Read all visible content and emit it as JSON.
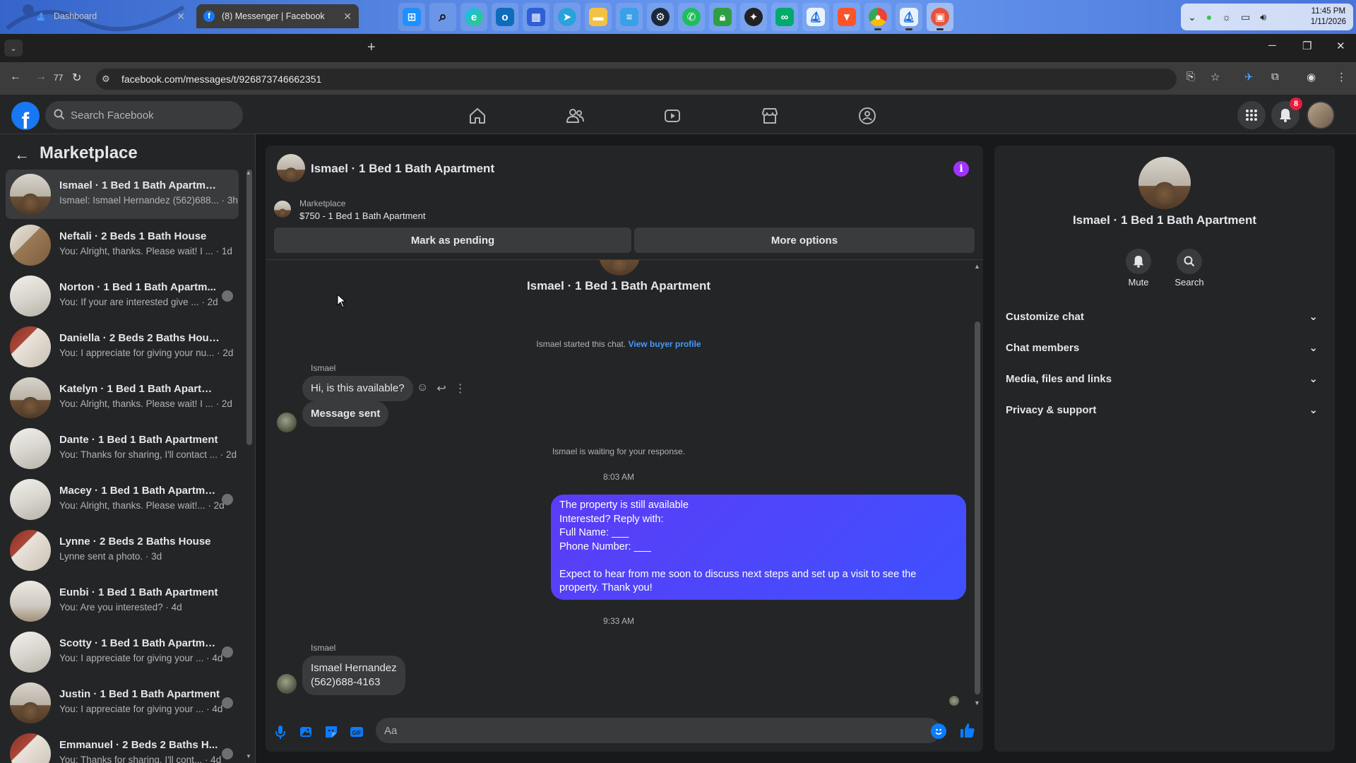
{
  "taskbar": {
    "icons": [
      "windows-start",
      "search",
      "edge-copilot",
      "outlook",
      "microsoft-store",
      "telegram",
      "file-explorer",
      "notepad",
      "steam",
      "whatsapp",
      "lock-app",
      "lightbulb-app",
      "tripadvisor",
      "sailing-app",
      "brave",
      "chrome",
      "sailing-app-2",
      "printer-app"
    ],
    "clock_time": "11:45 PM",
    "clock_date": "1/11/2026"
  },
  "browser": {
    "tabs": [
      {
        "title": "Dashboard",
        "active": false
      },
      {
        "title": "(8) Messenger | Facebook",
        "active": true
      }
    ],
    "reload_count": "77",
    "url": "facebook.com/messages/t/926873746662351"
  },
  "facebook": {
    "search_placeholder": "Search Facebook",
    "notification_count": "8"
  },
  "left": {
    "title": "Marketplace",
    "conversations": [
      {
        "name": "Ismael · 1 Bed 1 Bath Apartment",
        "snippet": "Ismael: Ismael Hernandez (562)688... · 3h",
        "thumb": "h1"
      },
      {
        "name": "Neftali · 2 Beds 1 Bath House",
        "snippet": "You: Alright, thanks. Please wait! I ... · 1d",
        "thumb": "h2"
      },
      {
        "name": "Norton · 1 Bed 1 Bath Apartm...",
        "snippet": "You: If your are interested give ... · 2d",
        "thumb": "h3"
      },
      {
        "name": "Daniella · 2 Beds 2 Baths House",
        "snippet": "You: I appreciate for giving your nu... · 2d",
        "thumb": "h4"
      },
      {
        "name": "Katelyn · 1 Bed 1 Bath Apartment",
        "snippet": "You: Alright, thanks. Please wait! I ... · 2d",
        "thumb": "h1"
      },
      {
        "name": "Dante · 1 Bed 1 Bath Apartment",
        "snippet": "You: Thanks for sharing, I'll contact ... · 2d",
        "thumb": "h3"
      },
      {
        "name": "Macey · 1 Bed 1 Bath Apartment",
        "snippet": "You: Alright, thanks. Please wait!... · 2d",
        "thumb": "h3"
      },
      {
        "name": "Lynne · 2 Beds 2 Baths House",
        "snippet": "Lynne sent a photo. · 3d",
        "thumb": "h4"
      },
      {
        "name": "Eunbi · 1 Bed 1 Bath Apartment",
        "snippet": "You: Are you interested? · 4d",
        "thumb": "h5"
      },
      {
        "name": "Scotty · 1 Bed 1 Bath Apartment",
        "snippet": "You: I appreciate for giving your ... · 4d",
        "thumb": "h3"
      },
      {
        "name": "Justin · 1 Bed 1 Bath Apartment",
        "snippet": "You: I appreciate for giving your ... · 4d",
        "thumb": "h1"
      },
      {
        "name": "Emmanuel · 2 Beds 2 Baths H...",
        "snippet": "You: Thanks for sharing. I'll cont... · 4d",
        "thumb": "h4"
      }
    ]
  },
  "chat": {
    "title": "Ismael · 1 Bed 1 Bath Apartment",
    "marketplace_label": "Marketplace",
    "listing": "$750 - 1 Bed 1 Bath Apartment",
    "mark_pending": "Mark as pending",
    "more_options": "More options",
    "center_title": "Ismael · 1 Bed 1 Bath Apartment",
    "started_text": "Ismael started this chat.",
    "view_profile": "View buyer profile",
    "sender1": "Ismael",
    "msg1": "Hi, is this available?",
    "msg2": "Message sent",
    "waiting": "Ismael is waiting for your response.",
    "time1": "8:03 AM",
    "my_msg": "The property is still available\nInterested? Reply with:\nFull Name: ___\nPhone Number: ___\n\nExpect to hear from me soon to discuss next steps and set up a visit to see the property. Thank you!",
    "time2": "9:33 AM",
    "sender2": "Ismael",
    "msg3": "Ismael Hernandez\n(562)688-4163",
    "composer_placeholder": "Aa"
  },
  "right": {
    "name": "Ismael · 1 Bed 1 Bath Apartment",
    "mute": "Mute",
    "search": "Search",
    "sections": [
      "Customize chat",
      "Chat members",
      "Media, files and links",
      "Privacy & support"
    ]
  },
  "colors": {
    "accent": "#0a7cff",
    "my_bubble": "#4b3df5",
    "info": "#a033ff"
  }
}
